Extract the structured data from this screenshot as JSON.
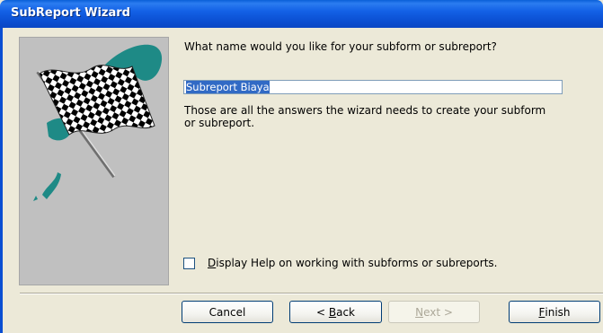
{
  "window": {
    "title": "SubReport Wizard"
  },
  "art": {
    "icon": "checkered-flag"
  },
  "main": {
    "question": "What name would you like for your subform or subreport?",
    "name_value": "Subreport Biaya",
    "info_line1": "Those are all the answers the wizard needs to create your subform",
    "info_line2": "or subreport.",
    "help_checkbox": {
      "label_prefix": "",
      "label_hotkey": "D",
      "label_rest": "isplay Help on working with subforms or subreports.",
      "checked": false
    }
  },
  "buttons": {
    "cancel": {
      "label": "Cancel"
    },
    "back": {
      "prefix": "< ",
      "hotkey": "B",
      "rest": "ack"
    },
    "next": {
      "prefix": "",
      "hotkey": "N",
      "rest": "ext >",
      "enabled": false
    },
    "finish": {
      "prefix": "",
      "hotkey": "F",
      "rest": "inish"
    }
  }
}
